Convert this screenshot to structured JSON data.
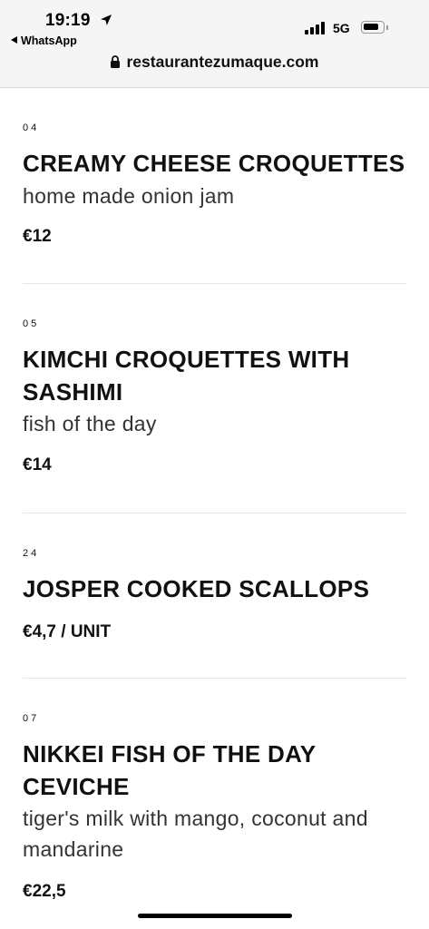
{
  "status_bar": {
    "time": "19:19",
    "back_app": "WhatsApp",
    "network": "5G",
    "battery_level": 0.85,
    "signal_bars": 4
  },
  "address_bar": {
    "url": "restaurantezumaque.com"
  },
  "menu_items": [
    {
      "number": "04",
      "name": "CREAMY CHEESE CROQUETTES",
      "description": "home made onion jam",
      "price": "€12"
    },
    {
      "number": "05",
      "name": "KIMCHI CROQUETTES WITH SASHIMI",
      "description": "fish of the day",
      "price": "€14"
    },
    {
      "number": "24",
      "name": "JOSPER COOKED SCALLOPS",
      "description": "",
      "price": "€4,7 / UNIT"
    },
    {
      "number": "07",
      "name": "NIKKEI FISH OF THE DAY CEVICHE",
      "description": "tiger's milk with mango, coconut and mandarine",
      "price": "€22,5"
    }
  ],
  "colors": {
    "text": "#111111",
    "topbar_bg": "#f5f5f5",
    "divider": "#e6e6e6"
  }
}
